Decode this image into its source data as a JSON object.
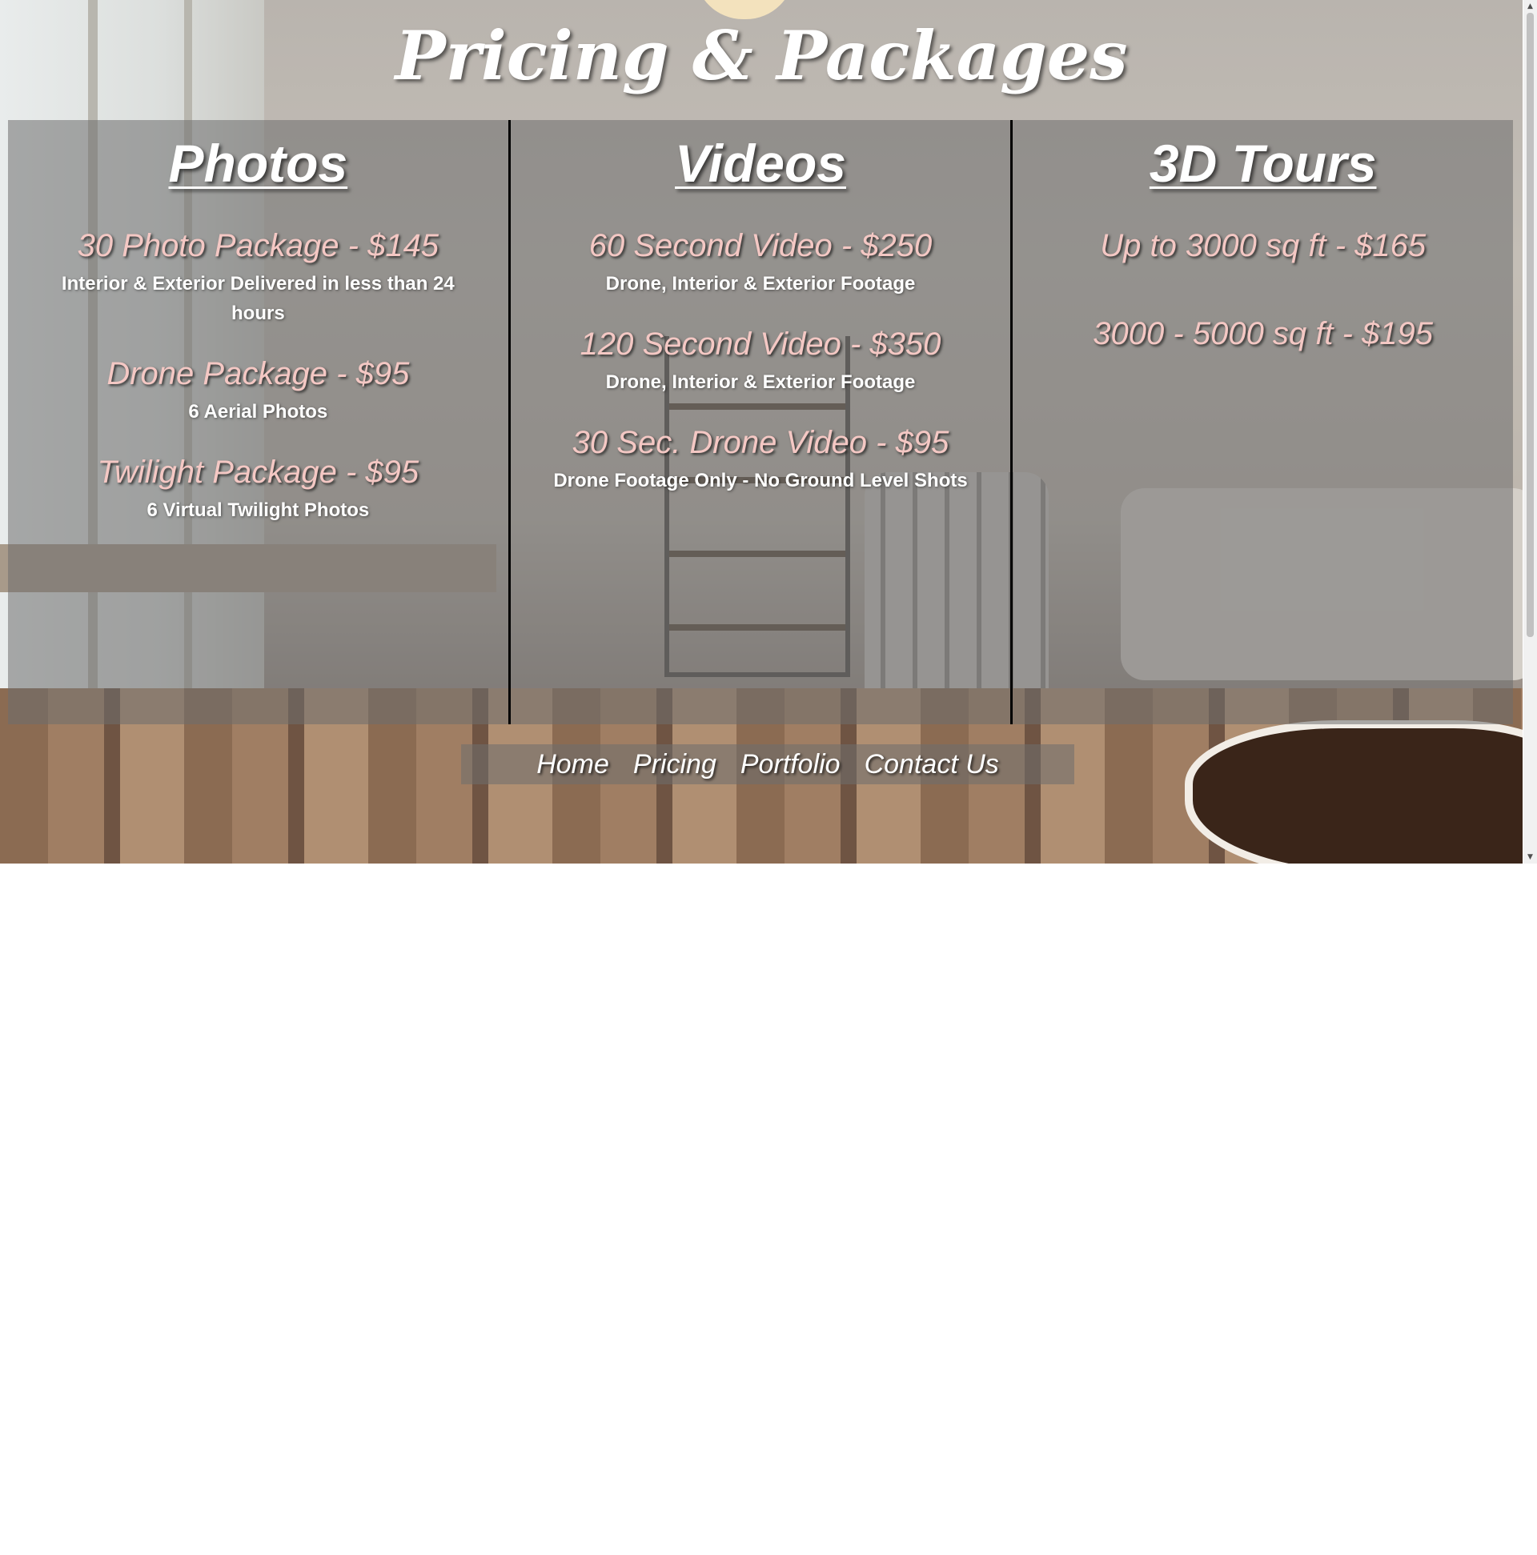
{
  "page": {
    "title": "Pricing & Packages"
  },
  "columns": [
    {
      "heading": "Photos",
      "packages": [
        {
          "title": "30 Photo Package - $145",
          "desc": "Interior & Exterior Delivered in less than 24 hours"
        },
        {
          "title": "Drone Package - $95",
          "desc": "6 Aerial Photos"
        },
        {
          "title": "Twilight Package - $95",
          "desc": "6 Virtual Twilight Photos"
        }
      ]
    },
    {
      "heading": "Videos",
      "packages": [
        {
          "title": "60 Second Video - $250",
          "desc": "Drone, Interior & Exterior Footage"
        },
        {
          "title": "120 Second Video - $350",
          "desc": "Drone, Interior & Exterior Footage"
        },
        {
          "title": "30 Sec. Drone Video - $95",
          "desc": "Drone Footage Only - No Ground Level Shots"
        }
      ]
    },
    {
      "heading": "3D Tours",
      "packages": [
        {
          "title": "Up to 3000 sq ft - $165"
        },
        {
          "title": "3000 - 5000 sq ft - $195"
        }
      ]
    }
  ],
  "nav": {
    "items": [
      "Home",
      "Pricing",
      "Portfolio",
      "Contact Us"
    ]
  },
  "colors": {
    "package_title": "#f4c8c4",
    "heading": "#ffffff",
    "overlay": "rgba(110,110,110,0.55)",
    "divider": "#000000"
  },
  "icons": {
    "scroll_up": "scroll-up-arrow-icon",
    "scroll_down": "scroll-down-arrow-icon"
  }
}
